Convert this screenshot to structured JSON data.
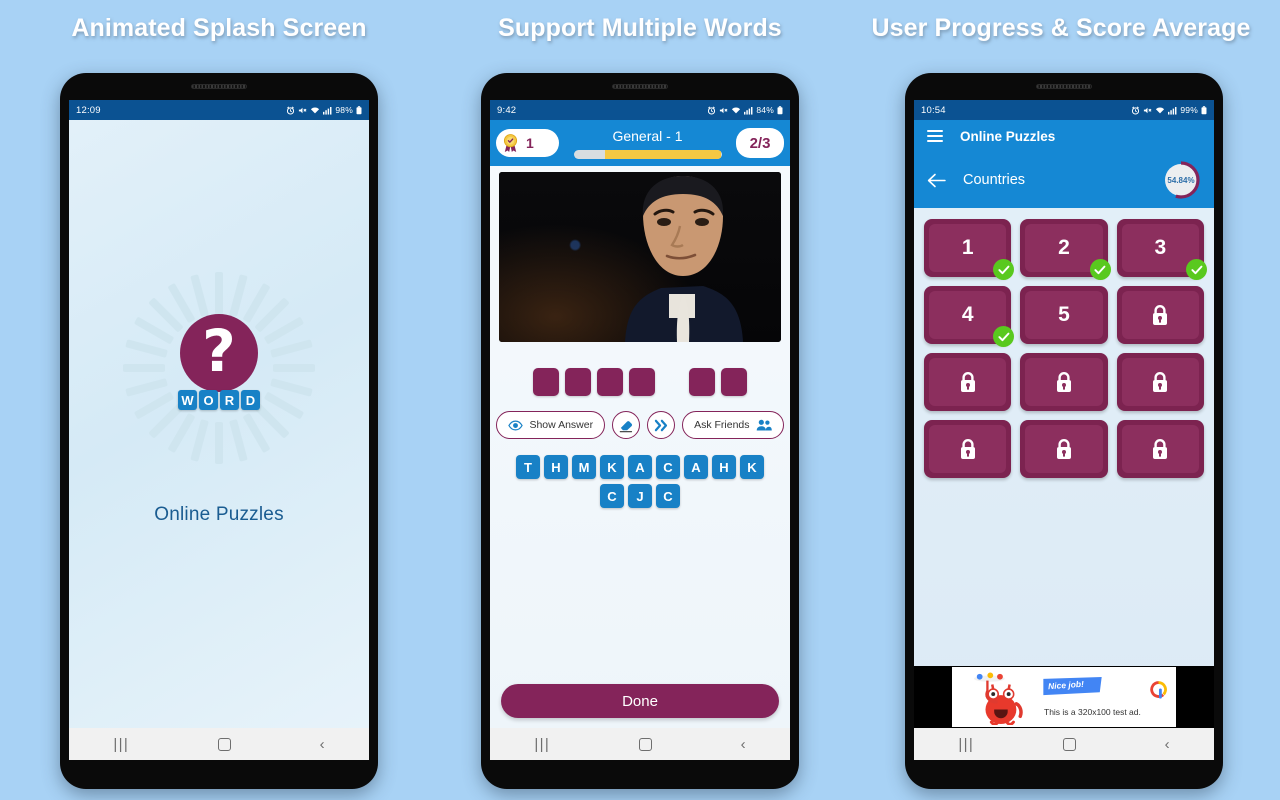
{
  "panels": [
    {
      "title": "Animated Splash Screen"
    },
    {
      "title": "Support Multiple Words"
    },
    {
      "title": "User Progress & Score Average"
    }
  ],
  "splash": {
    "status": {
      "time": "12:09",
      "battery": "98%"
    },
    "logo_word_tiles": [
      "W",
      "O",
      "R",
      "D"
    ],
    "question_mark": "?",
    "app_name": "Online Puzzles"
  },
  "quiz": {
    "status": {
      "time": "9:42",
      "battery": "84%"
    },
    "score": "1",
    "title": "General - 1",
    "counter": "2/3",
    "progress_percent": 79,
    "answer_tiles": [
      4,
      2
    ],
    "tools": {
      "show_answer_label": "Show Answer",
      "ask_friends_label": "Ask Friends"
    },
    "key_rows": [
      [
        "T",
        "H",
        "M",
        "K",
        "A",
        "C",
        "A",
        "H",
        "K"
      ],
      [
        "C",
        "J",
        "C"
      ]
    ],
    "done_label": "Done"
  },
  "levels": {
    "status": {
      "time": "10:54",
      "battery": "99%"
    },
    "app_title": "Online Puzzles",
    "category": "Countries",
    "progress_label": "54.84%",
    "progress_percent": 54.84,
    "items": [
      {
        "label": "1",
        "state": "completed"
      },
      {
        "label": "2",
        "state": "completed"
      },
      {
        "label": "3",
        "state": "completed"
      },
      {
        "label": "4",
        "state": "completed"
      },
      {
        "label": "5",
        "state": "open"
      },
      {
        "label": "",
        "state": "locked"
      },
      {
        "label": "",
        "state": "locked"
      },
      {
        "label": "",
        "state": "locked"
      },
      {
        "label": "",
        "state": "locked"
      },
      {
        "label": "",
        "state": "locked"
      },
      {
        "label": "",
        "state": "locked"
      },
      {
        "label": "",
        "state": "locked"
      }
    ],
    "ad": {
      "flag_text": "Nice job!",
      "body_text": "This is a 320x100 test ad."
    }
  },
  "colors": {
    "maroon": "#84245a",
    "blue": "#1588d4",
    "status_blue": "#0b5292",
    "tile_blue": "#1881c6",
    "green": "#59c91e",
    "yellow": "#f5c842",
    "page_bg": "#a8d2f5"
  }
}
